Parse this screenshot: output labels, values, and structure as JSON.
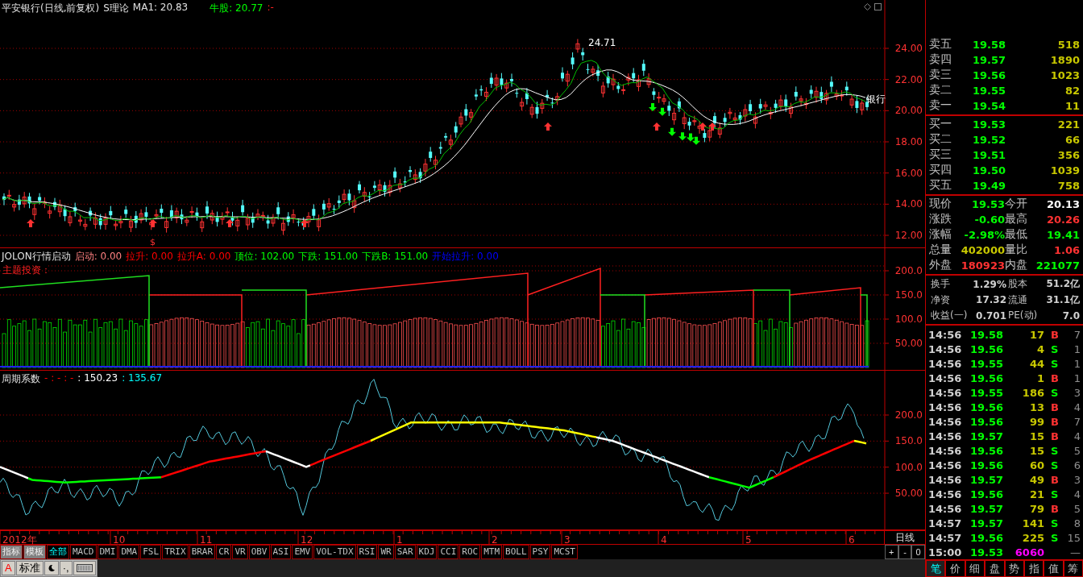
{
  "title_bar": {
    "stock": "平安银行(日线,前复权)",
    "indicator": "S理论",
    "ma1": "MA1: 20.83",
    "bull": "牛股: 20.77",
    "tail": ":-"
  },
  "price_panel": {
    "yticks": [
      "24.00",
      "22.00",
      "20.00",
      "18.00",
      "16.00",
      "14.00",
      "12.00"
    ],
    "peak_label": "24.71",
    "line_label": "银行",
    "marker": "$"
  },
  "jolon_panel": {
    "title": "JOLON行情启动",
    "values": [
      {
        "text": "启动: 0.00",
        "color": "#ff8080"
      },
      {
        "text": "拉升: 0.00",
        "color": "#ff0000"
      },
      {
        "text": "拉升A: 0.00",
        "color": "#ff0000"
      },
      {
        "text": "顶位: 102.00",
        "color": "#00ff00"
      },
      {
        "text": "下跌: 151.00",
        "color": "#00ff00"
      },
      {
        "text": "下跌B: 151.00",
        "color": "#00ff00"
      },
      {
        "text": "开始拉升: 0.00",
        "color": "#0000ff"
      }
    ],
    "subtitle": "主题投资：",
    "yticks": [
      "200.0",
      "150.0",
      "100.0",
      "50.00"
    ]
  },
  "cycle_panel": {
    "title": "周期系数",
    "values": [
      {
        "text": "- : - : -",
        "color": "#ff0000"
      },
      {
        "text": ": 150.23",
        "color": "#ffffff"
      },
      {
        "text": ": 135.67",
        "color": "#00ffff"
      }
    ],
    "yticks": [
      "200.0",
      "150.0",
      "100.0",
      "50.00"
    ]
  },
  "date_axis": {
    "labels": [
      "2012年",
      "10",
      "11",
      "12",
      "1",
      "2",
      "3",
      "4",
      "5",
      "6"
    ],
    "period": "日线"
  },
  "zoom_buttons": [
    "+",
    "-",
    "0"
  ],
  "indicator_tabs": [
    {
      "label": "指标",
      "kind": "menu",
      "selected": false
    },
    {
      "label": "模板",
      "kind": "menu",
      "selected": false
    },
    {
      "label": "全部",
      "kind": "indicator",
      "selected": true
    },
    {
      "label": "MACD",
      "kind": "indicator",
      "selected": false
    },
    {
      "label": "DMI",
      "kind": "indicator",
      "selected": false
    },
    {
      "label": "DMA",
      "kind": "indicator",
      "selected": false
    },
    {
      "label": "FSL",
      "kind": "indicator",
      "selected": false
    },
    {
      "label": "TRIX",
      "kind": "indicator",
      "selected": false
    },
    {
      "label": "BRAR",
      "kind": "indicator",
      "selected": false
    },
    {
      "label": "CR",
      "kind": "indicator",
      "selected": false
    },
    {
      "label": "VR",
      "kind": "indicator",
      "selected": false
    },
    {
      "label": "OBV",
      "kind": "indicator",
      "selected": false
    },
    {
      "label": "ASI",
      "kind": "indicator",
      "selected": false
    },
    {
      "label": "EMV",
      "kind": "indicator",
      "selected": false
    },
    {
      "label": "VOL-TDX",
      "kind": "indicator",
      "selected": false
    },
    {
      "label": "RSI",
      "kind": "indicator",
      "selected": false
    },
    {
      "label": "WR",
      "kind": "indicator",
      "selected": false
    },
    {
      "label": "SAR",
      "kind": "indicator",
      "selected": false
    },
    {
      "label": "KDJ",
      "kind": "indicator",
      "selected": false
    },
    {
      "label": "CCI",
      "kind": "indicator",
      "selected": false
    },
    {
      "label": "ROC",
      "kind": "indicator",
      "selected": false
    },
    {
      "label": "MTM",
      "kind": "indicator",
      "selected": false
    },
    {
      "label": "BOLL",
      "kind": "indicator",
      "selected": false
    },
    {
      "label": "PSY",
      "kind": "indicator",
      "selected": false
    },
    {
      "label": "MCST",
      "kind": "indicator",
      "selected": false
    }
  ],
  "ime_toolbar": {
    "letter": "A",
    "mode": "标准",
    "punct": "·,"
  },
  "order_book": {
    "sell": [
      {
        "label": "卖五",
        "price": "19.58",
        "volume": "518"
      },
      {
        "label": "卖四",
        "price": "19.57",
        "volume": "1890"
      },
      {
        "label": "卖三",
        "price": "19.56",
        "volume": "1023"
      },
      {
        "label": "卖二",
        "price": "19.55",
        "volume": "82"
      },
      {
        "label": "卖一",
        "price": "19.54",
        "volume": "11"
      }
    ],
    "buy": [
      {
        "label": "买一",
        "price": "19.53",
        "volume": "221"
      },
      {
        "label": "买二",
        "price": "19.52",
        "volume": "66"
      },
      {
        "label": "买三",
        "price": "19.51",
        "volume": "356"
      },
      {
        "label": "买四",
        "price": "19.50",
        "volume": "1039"
      },
      {
        "label": "买五",
        "price": "19.49",
        "volume": "758"
      }
    ]
  },
  "quote": [
    {
      "label": "现价",
      "value": "19.53",
      "color": "#00ff00"
    },
    {
      "label": "今开",
      "value": "20.13",
      "color": "#ffffff"
    },
    {
      "label": "涨跌",
      "value": "-0.60",
      "color": "#00ff00"
    },
    {
      "label": "最高",
      "value": "20.26",
      "color": "#ff3232"
    },
    {
      "label": "涨幅",
      "value": "-2.98%",
      "color": "#00ff00"
    },
    {
      "label": "最低",
      "value": "19.41",
      "color": "#00ff00"
    },
    {
      "label": "总量",
      "value": "402000",
      "color": "#c8c800"
    },
    {
      "label": "量比",
      "value": "1.06",
      "color": "#ff3232"
    },
    {
      "label": "外盘",
      "value": "180923",
      "color": "#ff3232"
    },
    {
      "label": "内盘",
      "value": "221077",
      "color": "#00ff00"
    }
  ],
  "fundamentals": [
    {
      "label": "换手",
      "value": "1.29%"
    },
    {
      "label": "股本",
      "value": "51.2亿"
    },
    {
      "label": "净资",
      "value": "17.32"
    },
    {
      "label": "流通",
      "value": "31.1亿"
    },
    {
      "label": "收益(一)",
      "value": "0.701"
    },
    {
      "label": "PE(动)",
      "value": "7.0"
    }
  ],
  "trades": [
    {
      "time": "14:56",
      "price": "19.58",
      "volume": "17",
      "side": "B",
      "kind": "buy",
      "count": "7"
    },
    {
      "time": "14:56",
      "price": "19.56",
      "volume": "4",
      "side": "S",
      "kind": "sell",
      "count": "1"
    },
    {
      "time": "14:56",
      "price": "19.55",
      "volume": "44",
      "side": "S",
      "kind": "sell",
      "count": "1"
    },
    {
      "time": "14:56",
      "price": "19.56",
      "volume": "1",
      "side": "B",
      "kind": "buy",
      "count": "1"
    },
    {
      "time": "14:56",
      "price": "19.55",
      "volume": "186",
      "side": "S",
      "kind": "sell",
      "count": "3"
    },
    {
      "time": "14:56",
      "price": "19.56",
      "volume": "13",
      "side": "B",
      "kind": "buy",
      "count": "4"
    },
    {
      "time": "14:56",
      "price": "19.56",
      "volume": "99",
      "side": "B",
      "kind": "buy",
      "count": "7"
    },
    {
      "time": "14:56",
      "price": "19.57",
      "volume": "15",
      "side": "B",
      "kind": "buy",
      "count": "4"
    },
    {
      "time": "14:56",
      "price": "19.56",
      "volume": "15",
      "side": "S",
      "kind": "sell",
      "count": "5"
    },
    {
      "time": "14:56",
      "price": "19.56",
      "volume": "60",
      "side": "S",
      "kind": "sell",
      "count": "6"
    },
    {
      "time": "14:56",
      "price": "19.57",
      "volume": "49",
      "side": "B",
      "kind": "buy",
      "count": "3"
    },
    {
      "time": "14:56",
      "price": "19.56",
      "volume": "21",
      "side": "S",
      "kind": "sell",
      "count": "4"
    },
    {
      "time": "14:56",
      "price": "19.57",
      "volume": "79",
      "side": "B",
      "kind": "buy",
      "count": "5"
    },
    {
      "time": "14:57",
      "price": "19.57",
      "volume": "141",
      "side": "S",
      "kind": "sell",
      "count": "8"
    },
    {
      "time": "14:57",
      "price": "19.56",
      "volume": "225",
      "side": "S",
      "kind": "sell",
      "count": "15"
    },
    {
      "time": "15:00",
      "price": "19.53",
      "volume": "6060",
      "kind": "close",
      "count": "—"
    }
  ],
  "detail_tabs": [
    {
      "label": "笔",
      "selected": true
    },
    {
      "label": "价",
      "selected": false
    },
    {
      "label": "细",
      "selected": false
    },
    {
      "label": "盘",
      "selected": false
    },
    {
      "label": "势",
      "selected": false
    },
    {
      "label": "指",
      "selected": false
    },
    {
      "label": "值",
      "selected": false
    },
    {
      "label": "筹",
      "selected": false
    }
  ]
}
